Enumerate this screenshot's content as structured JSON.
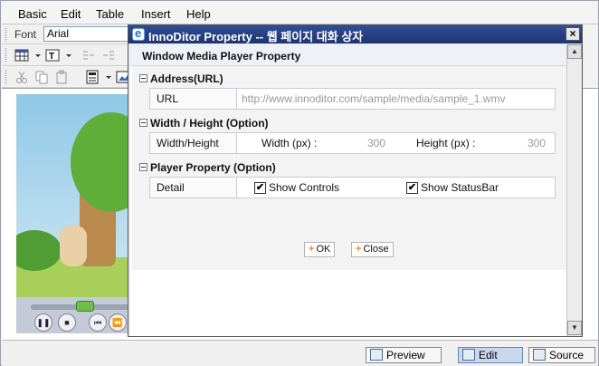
{
  "menu": [
    "Basic",
    "Edit",
    "Table",
    "Insert",
    "Help"
  ],
  "toolbar": {
    "font_label": "Font",
    "font_value": "Arial"
  },
  "status_buttons": {
    "preview": "Preview",
    "edit": "Edit",
    "source": "Source"
  },
  "dialog": {
    "title": "InnoDitor Property -- 웹 페이지 대화 상자",
    "close_glyph": "×",
    "header": "Window Media Player Property",
    "sections": {
      "address": {
        "title": "Address(URL)",
        "url_label": "URL",
        "url_value": "http://www.innoditor.com/sample/media/sample_1.wmv"
      },
      "size": {
        "title": "Width / Height (Option)",
        "row_label": "Width/Height",
        "width_label": "Width (px) :",
        "width_value": "300",
        "height_label": "Height (px) :",
        "height_value": "300"
      },
      "player": {
        "title": "Player Property (Option)",
        "row_label": "Detail",
        "show_controls_label": "Show Controls",
        "show_statusbar_label": "Show StatusBar",
        "check_glyph": "✔"
      }
    },
    "buttons": {
      "ok": "OK",
      "close": "Close",
      "plus": "+"
    }
  }
}
